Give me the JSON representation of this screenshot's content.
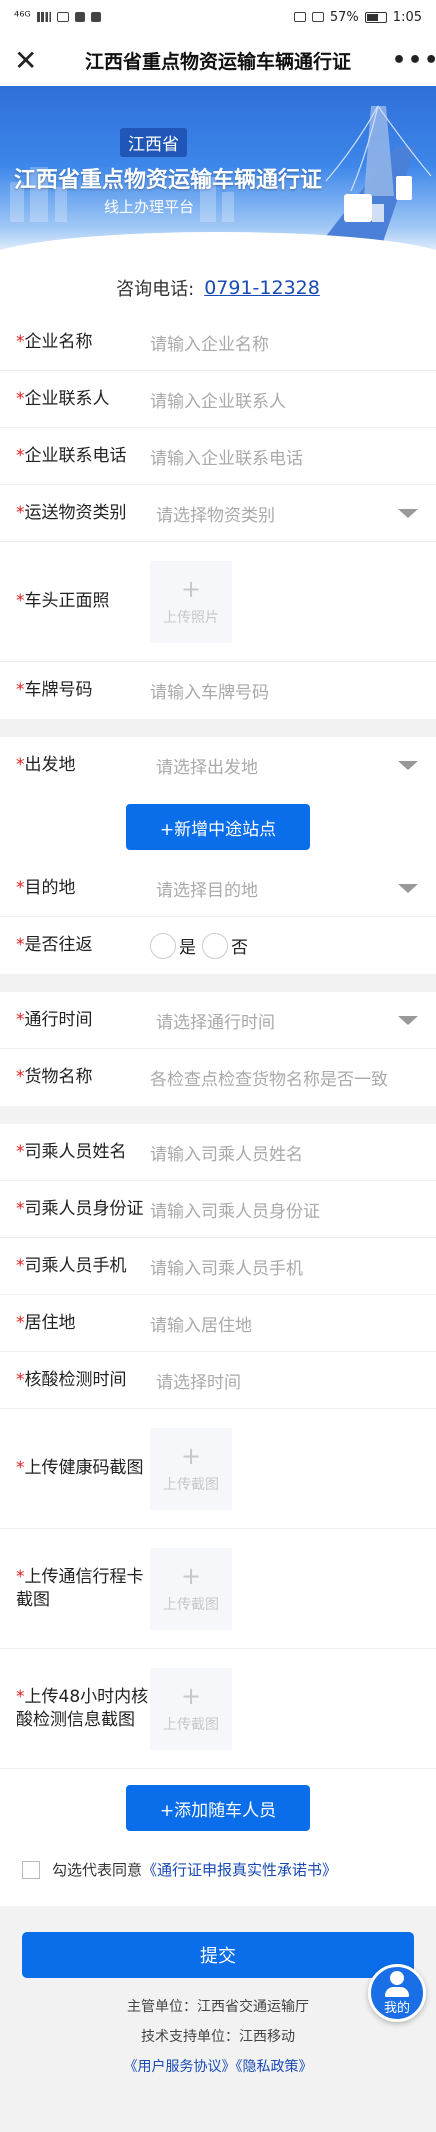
{
  "status_bar": {
    "left": "⁴⁶ᴳ",
    "battery": "57%",
    "time": "1:05"
  },
  "nav": {
    "title": "江西省重点物资运输车辆通行证"
  },
  "banner": {
    "badge": "江西省",
    "title": "江西省重点物资运输车辆通行证",
    "subtitle": "线上办理平台"
  },
  "hotline": {
    "label": "咨询电话:",
    "number": "0791-12328"
  },
  "form": {
    "company_name": {
      "label": "企业名称",
      "placeholder": "请输入企业名称"
    },
    "company_contact": {
      "label": "企业联系人",
      "placeholder": "请输入企业联系人"
    },
    "company_phone": {
      "label": "企业联系电话",
      "placeholder": "请输入企业联系电话"
    },
    "goods_type": {
      "label": "运送物资类别",
      "placeholder": "请选择物资类别"
    },
    "front_photo": {
      "label": "车头正面照",
      "upload": "上传照片"
    },
    "plate": {
      "label": "车牌号码",
      "placeholder": "请输入车牌号码"
    },
    "origin": {
      "label": "出发地",
      "placeholder": "请选择出发地"
    },
    "add_stop_button": "+新增中途站点",
    "destination": {
      "label": "目的地",
      "placeholder": "请选择目的地"
    },
    "round_trip": {
      "label": "是否往返",
      "yes": "是",
      "no": "否"
    },
    "travel_time": {
      "label": "通行时间",
      "placeholder": "请选择通行时间"
    },
    "cargo_name": {
      "label": "货物名称",
      "placeholder": "各检查点检查货物名称是否一致"
    },
    "driver_name": {
      "label": "司乘人员姓名",
      "placeholder": "请输入司乘人员姓名"
    },
    "driver_id": {
      "label": "司乘人员身份证",
      "placeholder": "请输入司乘人员身份证"
    },
    "driver_phone": {
      "label": "司乘人员手机",
      "placeholder": "请输入司乘人员手机"
    },
    "residence": {
      "label": "居住地",
      "placeholder": "请输入居住地"
    },
    "nucleic_time": {
      "label": "核酸检测时间",
      "placeholder": "请选择时间"
    },
    "health_code": {
      "label": "上传健康码截图",
      "upload": "上传截图"
    },
    "trip_card": {
      "label": "上传通信行程卡截图",
      "upload": "上传截图"
    },
    "nucleic_48h": {
      "label": "上传48小时内核酸检测信息截图",
      "upload": "上传截图"
    },
    "add_passenger_button": "+添加随车人员",
    "agree_text": "勾选代表同意",
    "agree_link": "《通行证申报真实性承诺书》"
  },
  "footer": {
    "submit": "提交",
    "authority": "主管单位：江西省交通运输厅",
    "support": "技术支持单位：江西移动",
    "links": "《用户服务协议》《隐私政策》"
  },
  "mine_button": "我的",
  "colors": {
    "primary": "#0a6dea",
    "required": "#e02020",
    "link": "#1a4ab5"
  }
}
